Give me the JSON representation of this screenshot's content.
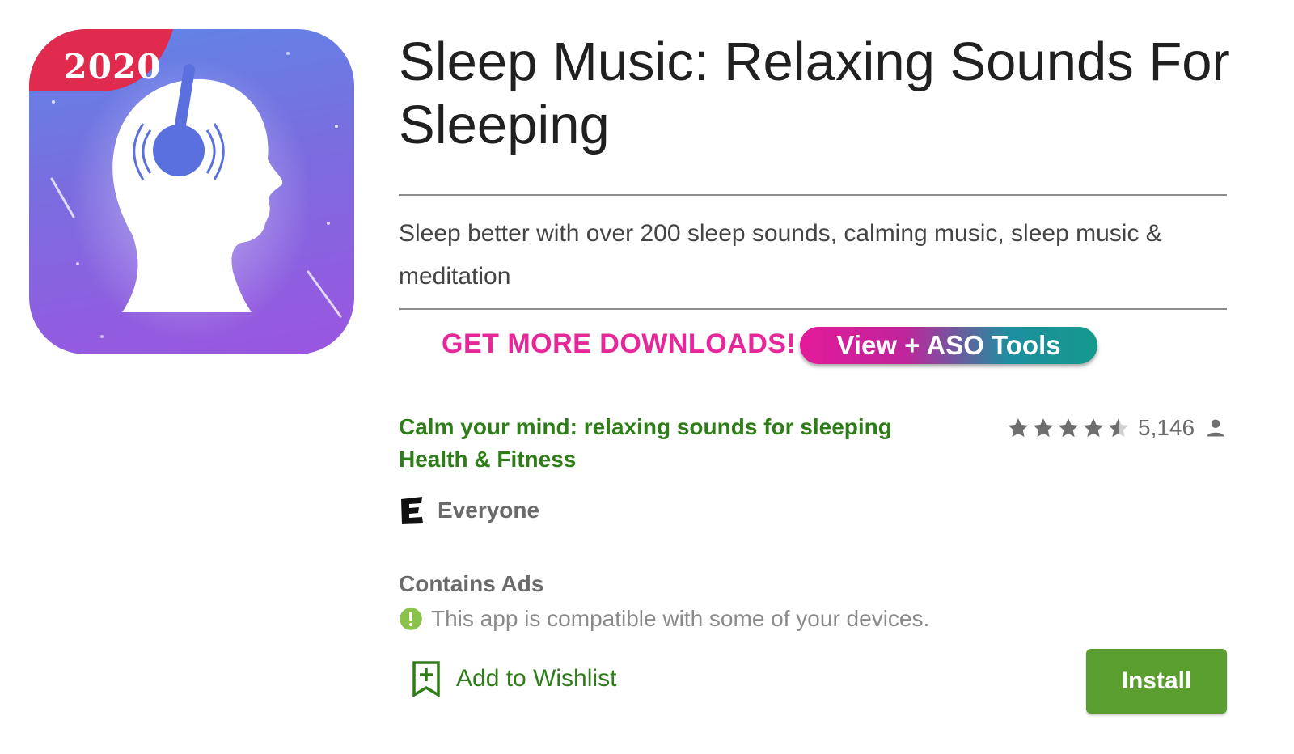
{
  "app": {
    "icon_badge": "2020",
    "title": "Sleep Music: Relaxing Sounds For Sleeping",
    "description": "Sleep better with over 200 sleep sounds, calming music, sleep music & meditation",
    "developer": "Calm your mind: relaxing sounds for sleeping",
    "category": "Health & Fitness",
    "rating": {
      "stars": 4.5,
      "count": "5,146"
    },
    "content_rating": "Everyone",
    "ads_notice": "Contains Ads",
    "compatibility": "This app is compatible with some of your devices."
  },
  "promo": {
    "text": "GET MORE DOWNLOADS!",
    "button_label": "View + ASO Tools"
  },
  "actions": {
    "wishlist_label": "Add to Wishlist",
    "install_label": "Install"
  },
  "colors": {
    "accent_green": "#2e7d18",
    "install_green": "#5a9e2f",
    "promo_pink": "#e5279a",
    "badge_red": "#e02a4e"
  }
}
